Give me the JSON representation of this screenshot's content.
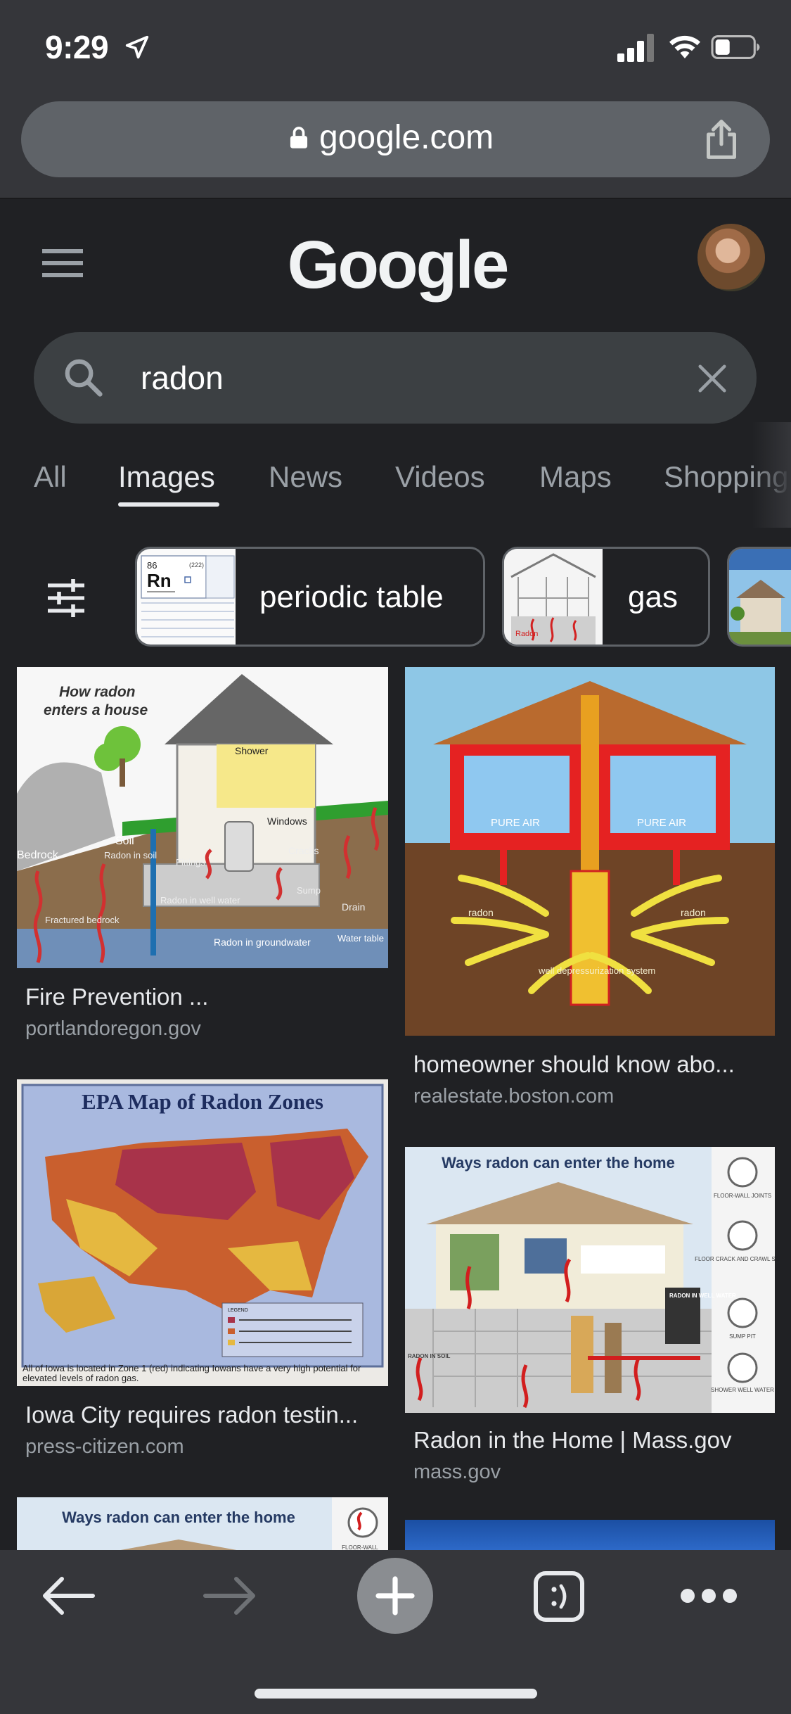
{
  "status_bar": {
    "time": "9:29"
  },
  "browser": {
    "url": "google.com"
  },
  "header": {
    "logo": "Google"
  },
  "search": {
    "query": "radon"
  },
  "tabs": [
    {
      "label": "All",
      "active": false
    },
    {
      "label": "Images",
      "active": true
    },
    {
      "label": "News",
      "active": false
    },
    {
      "label": "Videos",
      "active": false
    },
    {
      "label": "Maps",
      "active": false
    },
    {
      "label": "Shopping",
      "active": false
    }
  ],
  "chips": [
    {
      "label": "periodic table",
      "thumb": {
        "element_number": "86",
        "atomic_mass": "(222)",
        "symbol": "Rn"
      }
    },
    {
      "label": "gas",
      "thumb": {
        "caption": "Radon"
      }
    }
  ],
  "results": [
    {
      "title": "Fire Prevention ...",
      "source": "portlandoregon.gov",
      "image_text": {
        "heading": "How radon enters a house",
        "heading_line1": "How radon",
        "heading_line2": "enters a house",
        "shower": "Shower",
        "windows": "Windows",
        "soil": "Soil",
        "radon_in_soil": "Radon in soil",
        "bedrock": "Bedrock",
        "fittings": "Fittings",
        "cracks": "Cracks",
        "sump": "Sump",
        "drain": "Drain",
        "radon_in_well_water": "Radon in well water",
        "fractured_bedrock": "Fractured bedrock",
        "radon_in_groundwater": "Radon in groundwater",
        "water_table": "Water table"
      }
    },
    {
      "title": "homeowner should know abo...",
      "source": "realestate.boston.com",
      "image_text": {
        "pure_air_left": "PURE AIR",
        "pure_air_right": "PURE AIR",
        "radon_left": "radon",
        "radon_right": "radon",
        "system": "well depressurization system"
      }
    },
    {
      "title": "Iowa City requires radon testin...",
      "source": "press-citizen.com",
      "image_text": {
        "heading": "EPA Map of Radon Zones",
        "caption": "All of Iowa is located in Zone 1 (red) indicating Iowans have a very high potential for elevated levels of radon gas.",
        "legend_title": "LEGEND"
      }
    },
    {
      "title": "Radon in the Home | Mass.gov",
      "source": "mass.gov",
      "image_text": {
        "heading": "Ways radon can enter the home",
        "side_labels": [
          "FLOOR-WALL JOINTS",
          "FLOOR CRACK AND CRAWL SPACE",
          "SUMP PIT",
          "SHOWER WELL WATER"
        ],
        "radon_in_well_water": "RADON IN WELL WATER",
        "radon_in_soil": "RADON IN SOIL"
      }
    },
    {
      "title": "",
      "source": "",
      "image_text": {
        "heading": "Ways radon can enter the home",
        "side_label": "FLOOR-WALL"
      }
    }
  ],
  "colors": {
    "background": "#202124",
    "chrome": "#35363a",
    "url_pill": "#5f6368",
    "search_pill": "#3c4043",
    "text": "#e8eaed",
    "muted": "#9aa0a6"
  },
  "icons": [
    "location-arrow-icon",
    "signal-icon",
    "wifi-icon",
    "battery-icon",
    "lock-icon",
    "share-icon",
    "hamburger-menu-icon",
    "search-icon",
    "clear-icon",
    "filter-icon",
    "back-arrow-icon",
    "forward-arrow-icon",
    "new-tab-plus-icon",
    "tab-switcher-icon",
    "more-menu-icon"
  ]
}
